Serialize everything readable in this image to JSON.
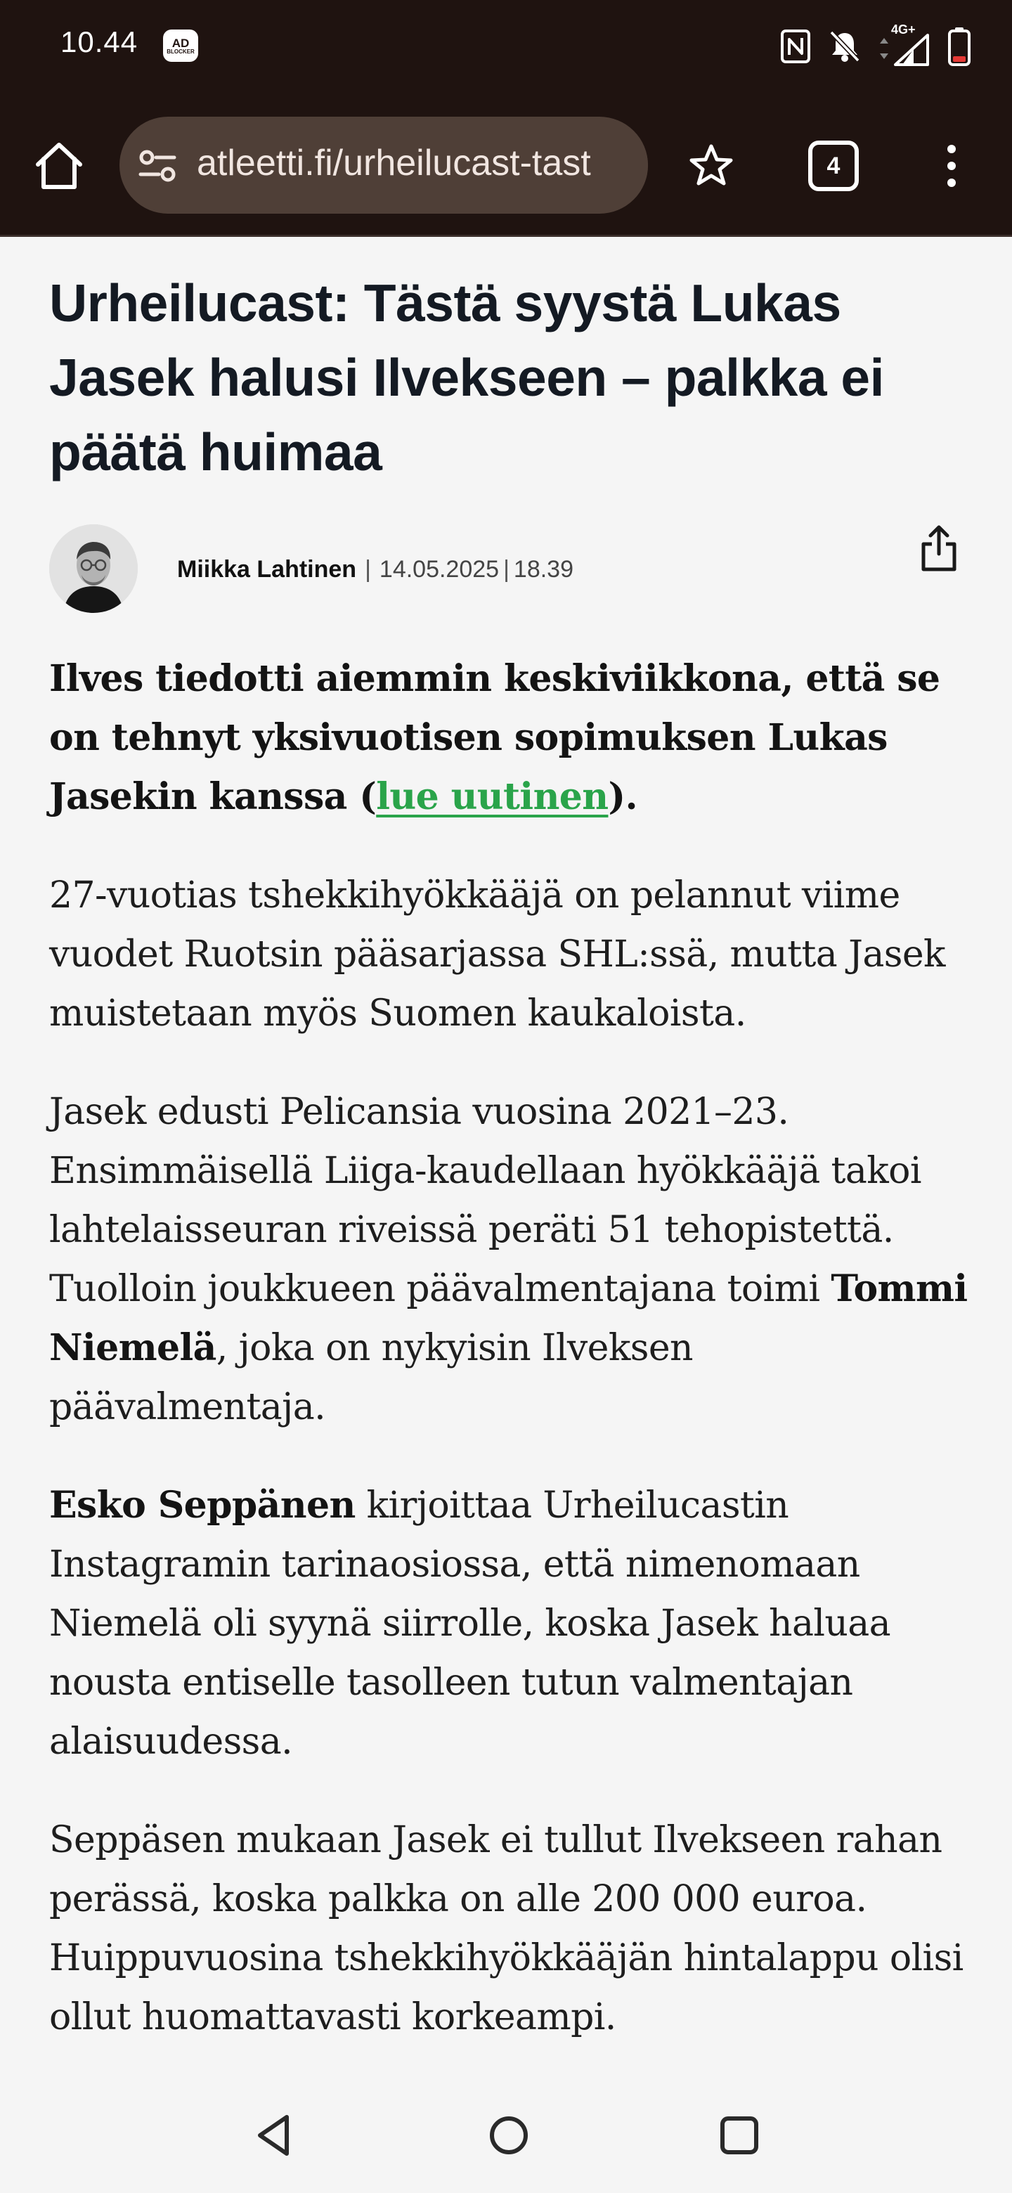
{
  "status_bar": {
    "time": "10.44",
    "adblock_badge_line1": "AD",
    "adblock_badge_line2": "BLOCKER",
    "network_label": "4G+"
  },
  "browser": {
    "url": "atleetti.fi/urheilucast-tast",
    "tab_count": "4"
  },
  "article": {
    "headline": "Urheilucast: Tästä syystä Lukas Jasek halusi Ilvekseen – palkka ei päätä huimaa",
    "author": "Miikka Lahtinen",
    "date": "14.05.2025",
    "time": "18.39",
    "lead_before_link": "Ilves tiedotti aiemmin keskiviikkona, että se on tehnyt yksivuotisen sopimuksen Lukas Jasekin kanssa (",
    "lead_link": "lue uutinen",
    "lead_after_link": ").",
    "p1": "27-vuotias tshekkihyökkääjä on pelannut viime vuodet Ruotsin pääsarjassa SHL:ssä, mutta Jasek muistetaan myös Suomen kaukaloista.",
    "p2_text": "Jasek edusti Pelicansia vuosina 2021–23. Ensimmäisellä Liiga-kaudellaan hyökkääjä takoi lahtelaisseuran riveissä peräti 51 tehopistettä. Tuolloin joukkueen päävalmentajana toimi ",
    "p2_bold": "Tommi Niemelä",
    "p2_end": ", joka on nykyisin Ilveksen päävalmentaja.",
    "p3_bold": "Esko Seppänen",
    "p3_text": " kirjoittaa Urheilucastin Instagramin tarinaosiossa, että nimenomaan Niemelä oli syynä siirrolle, koska Jasek haluaa nousta entiselle tasolleen tutun valmentajan alaisuudessa.",
    "p4": "Seppäsen mukaan Jasek ei tullut Ilvekseen rahan perässä, koska palkka on alle 200 000 euroa. Huippuvuosina tshekkihyökkääjän hintalappu olisi ollut huomattavasti korkeampi."
  },
  "icons": {
    "home": "home-icon",
    "tune": "page-info-icon",
    "star": "bookmark-star-icon",
    "tabs": "tab-switcher-icon",
    "menu": "overflow-menu-icon",
    "share": "share-icon",
    "back": "nav-back-icon",
    "nav_home": "nav-home-icon",
    "recents": "nav-recents-icon"
  },
  "colors": {
    "chrome_bg": "#1f1310",
    "urlbar_bg": "#4f3f37",
    "link": "#2aa44a",
    "page_bg": "#f5f5f5"
  }
}
